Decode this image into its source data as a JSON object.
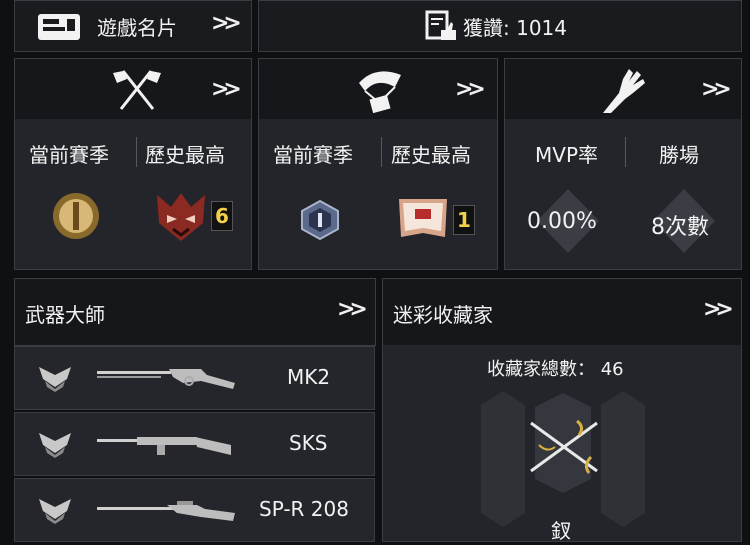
{
  "top": {
    "game_card_label": "遊戲名片",
    "likes_label": "獲讚: 1014"
  },
  "cards": {
    "ranked": {
      "current_label": "當前賽季",
      "best_label": "歷史最高",
      "best_tier_count": "6"
    },
    "br": {
      "current_label": "當前賽季",
      "best_label": "歷史最高",
      "best_tier_count": "1"
    },
    "zombie": {
      "mvp_label": "MVP率",
      "wins_label": "勝場",
      "mvp_value": "0.00%",
      "wins_value": "8次數"
    }
  },
  "weapon_master": {
    "title": "武器大師",
    "weapons": [
      {
        "name": "MK2"
      },
      {
        "name": "SKS"
      },
      {
        "name": "SP-R 208"
      }
    ]
  },
  "camo_collector": {
    "title": "迷彩收藏家",
    "total_label": "收藏家總數： 46",
    "item_name": "釵"
  },
  "colors": {
    "gold": "#f3d24a",
    "panel": "#23252a",
    "header": "#16171a"
  }
}
